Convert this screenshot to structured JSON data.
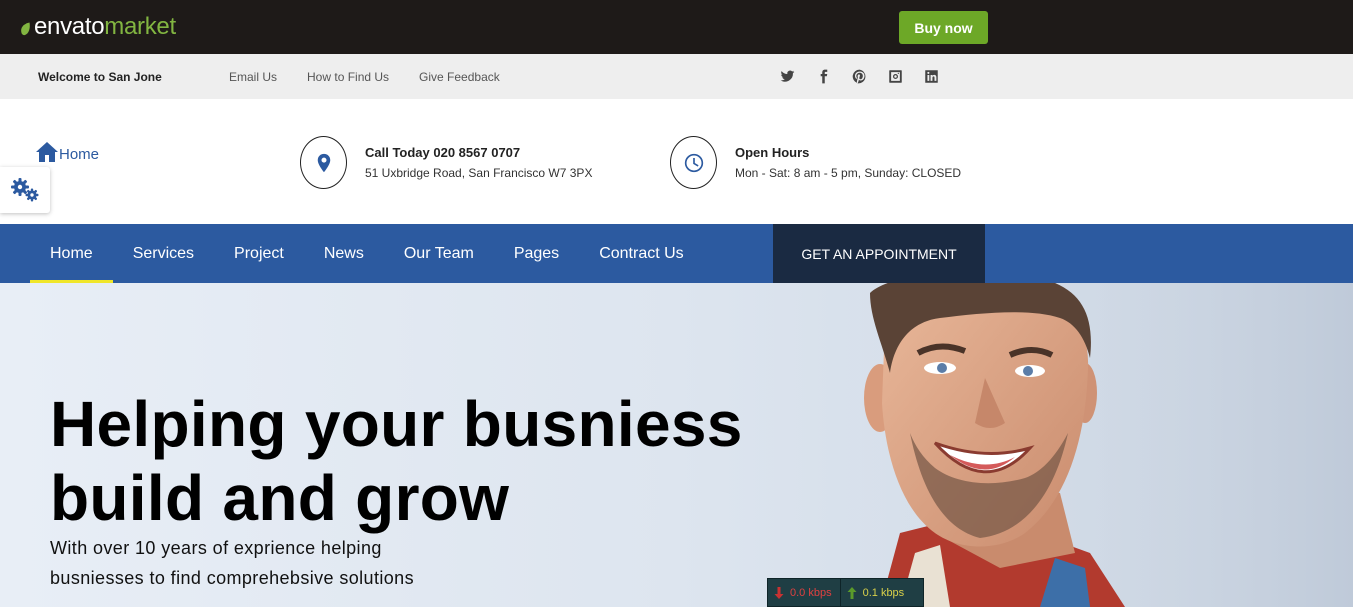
{
  "envato": {
    "logo_word1": "envato",
    "logo_word2": "market",
    "buy_label": "Buy now",
    "brand_color": "#82b541",
    "button_color": "#6da827"
  },
  "topbar": {
    "welcome": "Welcome to San Jone",
    "links": [
      "Email Us",
      "How to Find Us",
      "Give Feedback"
    ],
    "socials": [
      "twitter-icon",
      "facebook-icon",
      "pinterest-icon",
      "instagram-icon",
      "linkedin-icon"
    ]
  },
  "header": {
    "home_label": "Home",
    "call": {
      "icon": "map-pin-icon",
      "title": "Call Today 020 8567 0707",
      "text": "51 Uxbridge Road, San Francisco W7 3PX"
    },
    "hours": {
      "icon": "clock-icon",
      "title": "Open Hours",
      "text": "Mon - Sat: 8 am - 5 pm, Sunday: CLOSED"
    },
    "settings_icon": "gears-icon"
  },
  "nav": {
    "items": [
      "Home",
      "Services",
      "Project",
      "News",
      "Our Team",
      "Pages",
      "Contract Us"
    ],
    "active": "Home",
    "appointment_label": "GET AN APPOINTMENT",
    "nav_color": "#2c5aa0",
    "appointment_color": "#1a2a42",
    "active_underline_color": "#f0e62a"
  },
  "hero": {
    "title_line1": "Helping your busniess",
    "title_line2": "build and grow",
    "sub_line1": "With over 10 years of exprience helping",
    "sub_line2": "busniesses to find comprehebsive solutions"
  },
  "netspeed": {
    "down": "0.0 kbps",
    "up": "0.1 kbps"
  }
}
